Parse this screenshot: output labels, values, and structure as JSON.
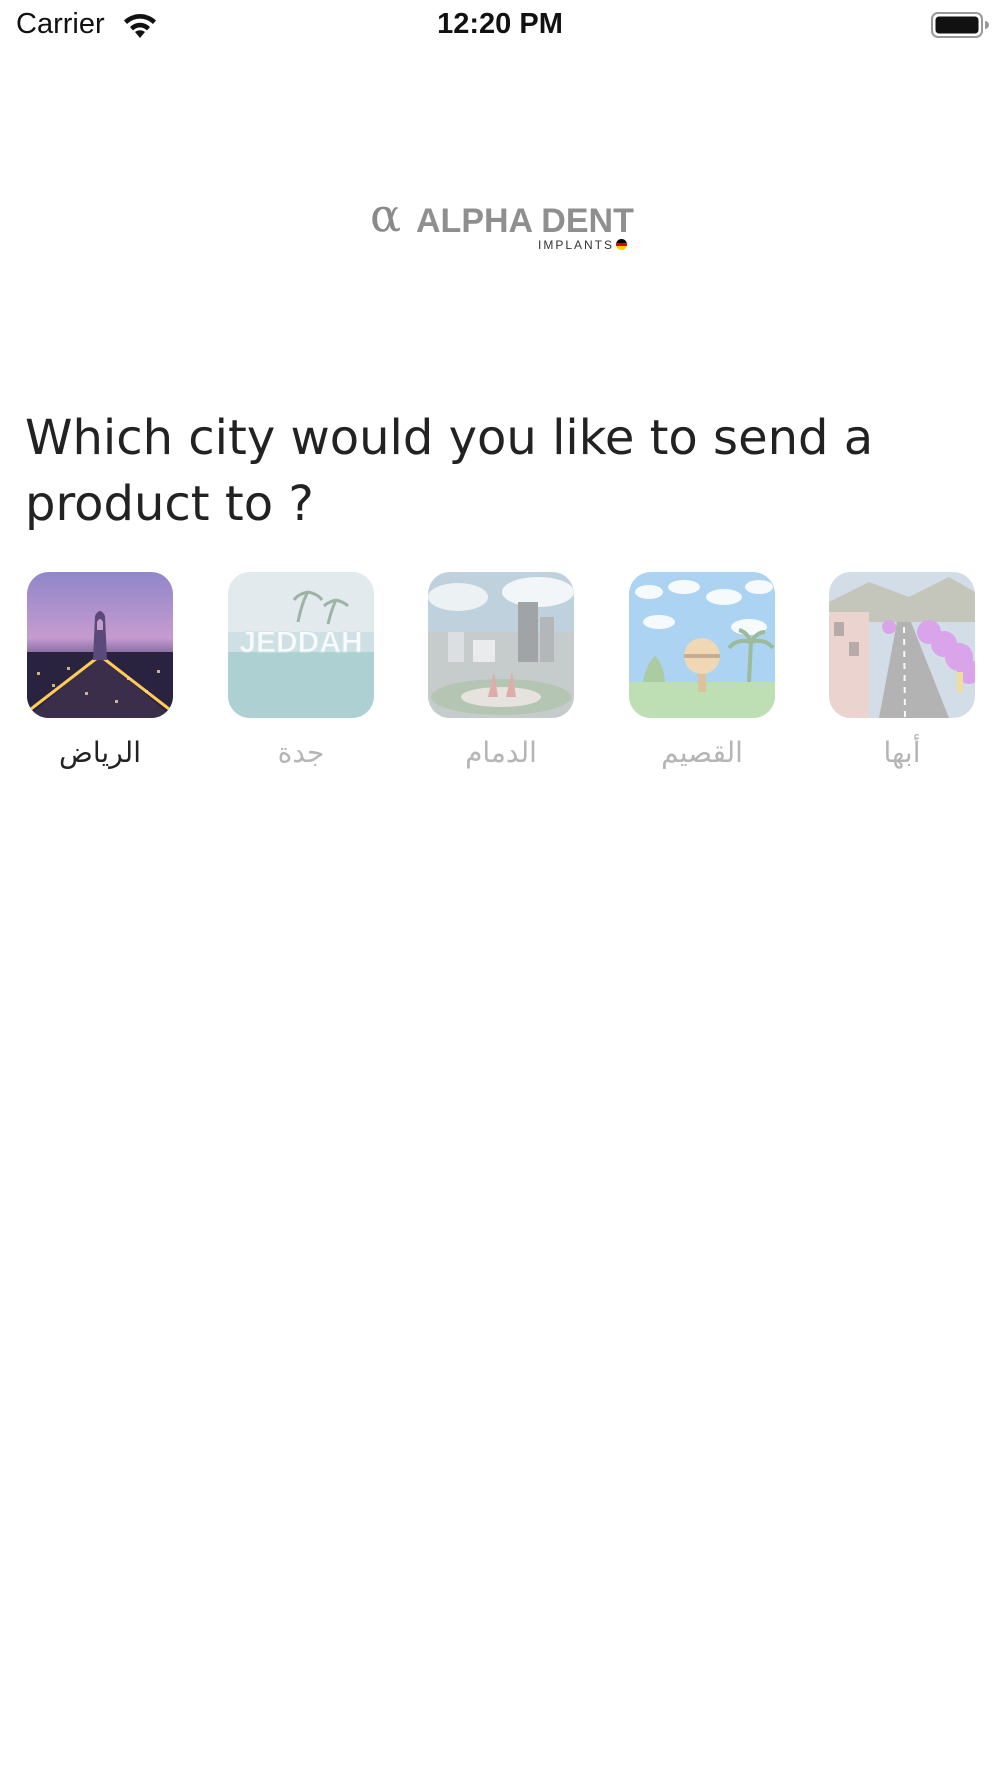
{
  "status_bar": {
    "carrier": "Carrier",
    "time": "12:20 PM",
    "icons": [
      "wifi-icon",
      "battery-icon"
    ]
  },
  "logo": {
    "symbol": "α",
    "name": "ALPHA DENT",
    "sub": "IMPLANTS"
  },
  "question": "Which city would you like to send a product to ?",
  "cities": [
    {
      "label": "الرياض",
      "selected": true
    },
    {
      "label": "جدة",
      "selected": false,
      "image_text": "JEDDAH"
    },
    {
      "label": "الدمام",
      "selected": false
    },
    {
      "label": "القصيم",
      "selected": false
    },
    {
      "label": "أبها",
      "selected": false
    }
  ]
}
